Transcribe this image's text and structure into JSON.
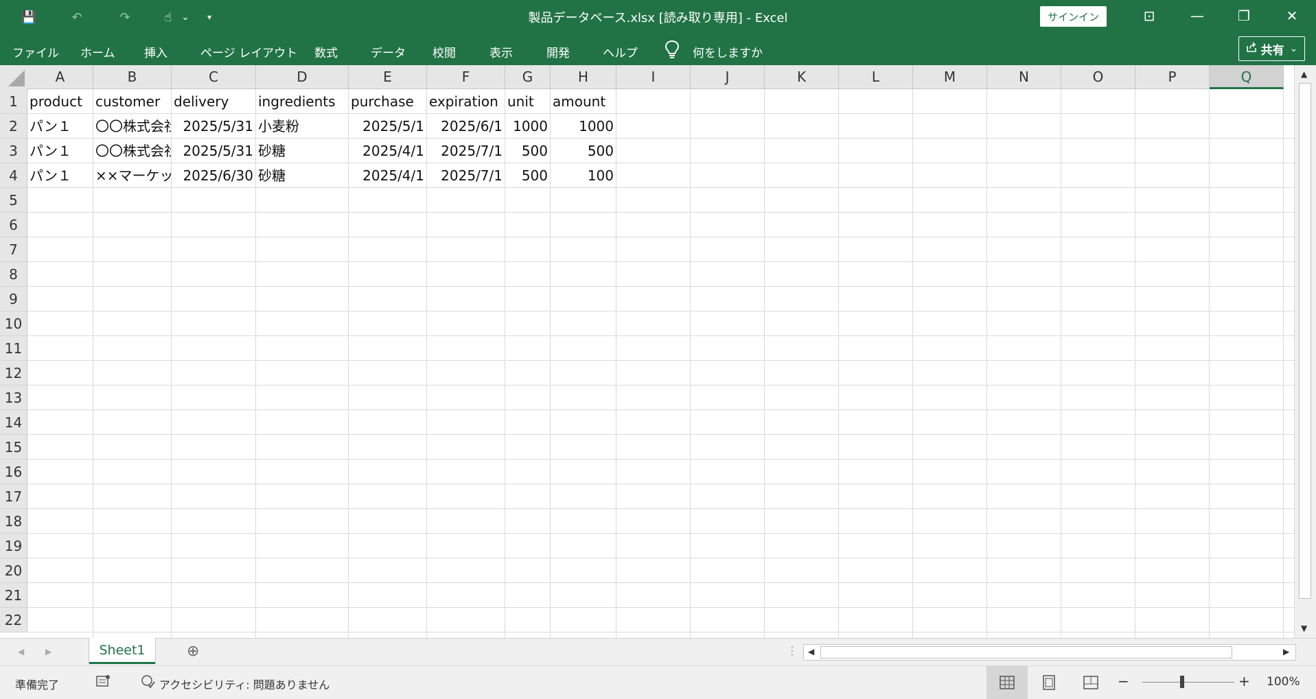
{
  "window": {
    "title": "製品データベース.xlsx  [読み取り専用]  -  Excel",
    "signin_label": "サインイン"
  },
  "quick_access": {
    "save": "💾",
    "undo": "↶",
    "redo": "↷",
    "touch": "☝",
    "touch_dropdown": "⌄",
    "customize": "▾"
  },
  "window_controls": {
    "ribbon_display": "⊡",
    "minimize": "—",
    "restore": "❐",
    "close": "✕"
  },
  "menu": [
    {
      "label": "ファイル"
    },
    {
      "label": "ホーム"
    },
    {
      "label": "挿入"
    },
    {
      "label": "ページ レイアウト"
    },
    {
      "label": "数式"
    },
    {
      "label": "データ"
    },
    {
      "label": "校閲"
    },
    {
      "label": "表示"
    },
    {
      "label": "開発"
    },
    {
      "label": "ヘルプ"
    }
  ],
  "tell_me": {
    "icon": "lightbulb-icon",
    "label": "何をしますか"
  },
  "share": {
    "label": "共有",
    "chevron": "⌄"
  },
  "columns": [
    "A",
    "B",
    "C",
    "D",
    "E",
    "F",
    "G",
    "H",
    "I",
    "J",
    "K",
    "L",
    "M",
    "N",
    "O",
    "P",
    "Q"
  ],
  "rows": [
    "1",
    "2",
    "3",
    "4",
    "5",
    "6",
    "7",
    "8",
    "9",
    "10",
    "11",
    "12",
    "13",
    "14",
    "15",
    "16",
    "17",
    "18",
    "19",
    "20",
    "21",
    "22"
  ],
  "sheet_cells": [
    [
      "product",
      "customer",
      "delivery",
      "ingredients",
      "purchase",
      "expiration",
      "unit",
      "amount"
    ],
    [
      "パン１",
      "〇〇株式会社",
      "2025/5/31",
      "小麦粉",
      "2025/5/1",
      "2025/6/1",
      "1000",
      "1000"
    ],
    [
      "パン１",
      "〇〇株式会社",
      "2025/5/31",
      "砂糖",
      "2025/4/1",
      "2025/7/1",
      "500",
      "500"
    ],
    [
      "パン１",
      "××マーケット",
      "2025/6/30",
      "砂糖",
      "2025/4/1",
      "2025/7/1",
      "500",
      "100"
    ]
  ],
  "selected_column": "Q",
  "sheet_tabs": [
    {
      "label": "Sheet1"
    }
  ],
  "add_sheet": "⊕",
  "status": {
    "ready": "準備完了",
    "accessibility": "アクセシビリティ: 問題ありません",
    "zoom": "100%",
    "zoom_minus": "−",
    "zoom_plus": "+"
  }
}
